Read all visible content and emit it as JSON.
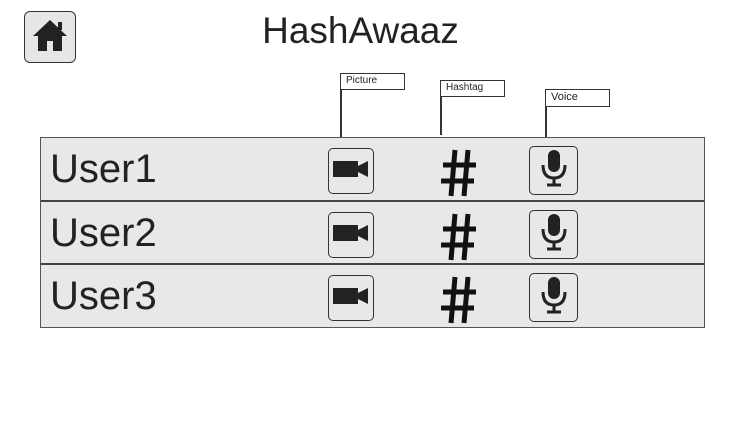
{
  "header": {
    "title": "HashAwaaz",
    "home_icon": "home-icon"
  },
  "callouts": {
    "picture": "Picture",
    "hashtag": "Hashtag",
    "voice": "Voice"
  },
  "users": [
    {
      "name": "User1",
      "picture_icon": "video-camera-icon",
      "hashtag_icon": "hashtag-icon",
      "voice_icon": "microphone-icon"
    },
    {
      "name": "User2",
      "picture_icon": "video-camera-icon",
      "hashtag_icon": "hashtag-icon",
      "voice_icon": "microphone-icon"
    },
    {
      "name": "User3",
      "picture_icon": "video-camera-icon",
      "hashtag_icon": "hashtag-icon",
      "voice_icon": "microphone-icon"
    }
  ]
}
